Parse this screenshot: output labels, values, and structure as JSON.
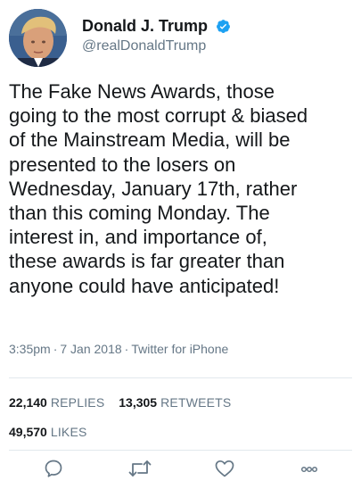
{
  "user": {
    "display_name": "Donald J. Trump",
    "handle": "@realDonaldTrump",
    "verified": true,
    "verified_color": "#1da1f2"
  },
  "tweet": {
    "text": "The Fake News Awards, those\ngoing to the most corrupt & biased\nof the Mainstream Media, will be\npresented to the losers on\nWednesday, January 17th, rather\nthan this coming Monday. The\ninterest in, and importance of,\nthese awards is far greater than\nanyone could have anticipated!",
    "time": "3:35pm",
    "date": "7 Jan 2018",
    "source": "Twitter for iPhone",
    "separator": "·"
  },
  "stats": {
    "replies_count": "22,140",
    "replies_label": "REPLIES",
    "retweets_count": "13,305",
    "retweets_label": "RETWEETS",
    "likes_count": "49,570",
    "likes_label": "LIKES"
  },
  "actions": [
    {
      "name": "reply",
      "icon": "reply-icon"
    },
    {
      "name": "retweet",
      "icon": "retweet-icon"
    },
    {
      "name": "like",
      "icon": "heart-icon"
    },
    {
      "name": "more",
      "icon": "more-icon"
    }
  ],
  "colors": {
    "text_primary": "#14171a",
    "text_secondary": "#657786",
    "divider": "#e1e8ed",
    "icon": "#657786"
  }
}
